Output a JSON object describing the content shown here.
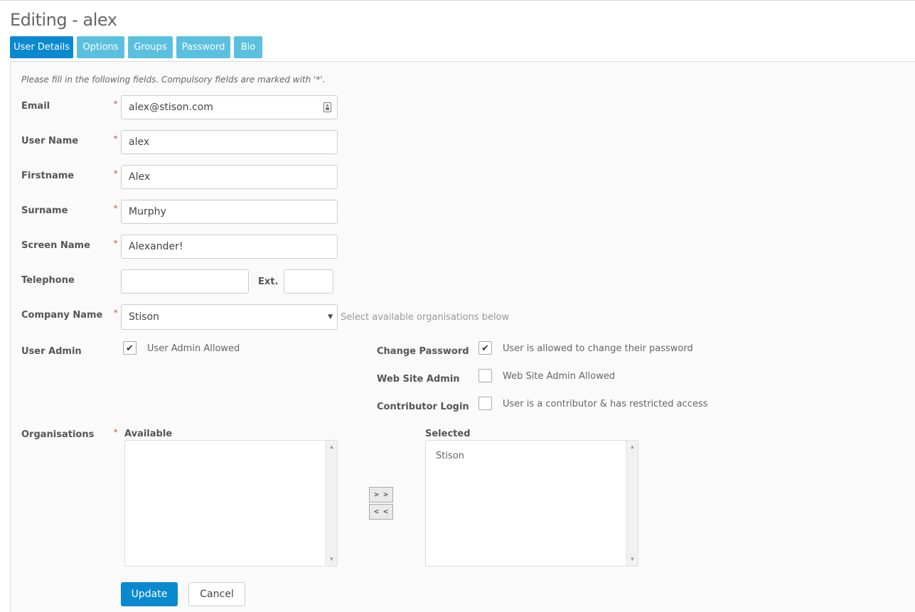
{
  "page": {
    "title": "Editing - alex"
  },
  "tabs": [
    {
      "label": "User Details"
    },
    {
      "label": "Options"
    },
    {
      "label": "Groups"
    },
    {
      "label": "Password"
    },
    {
      "label": "Bio"
    }
  ],
  "form": {
    "instructions": "Please fill in the following fields. Compulsory fields are marked with '*'.",
    "required_marker": "*",
    "email": {
      "label": "Email",
      "value": "alex@stison.com"
    },
    "username": {
      "label": "User Name",
      "value": "alex"
    },
    "firstname": {
      "label": "Firstname",
      "value": "Alex"
    },
    "surname": {
      "label": "Surname",
      "value": "Murphy"
    },
    "screenname": {
      "label": "Screen Name",
      "value": "Alexander!"
    },
    "telephone": {
      "label": "Telephone",
      "value": "",
      "ext_label": "Ext.",
      "ext_value": ""
    },
    "company": {
      "label": "Company Name",
      "value": "Stison",
      "hint": "Select available organisations below"
    },
    "user_admin": {
      "label": "User Admin",
      "checkbox_label": "User Admin Allowed",
      "checked": true
    },
    "change_password": {
      "label": "Change Password",
      "checkbox_label": "User is allowed to change their password",
      "checked": true
    },
    "web_site_admin": {
      "label": "Web Site Admin",
      "checkbox_label": "Web Site Admin Allowed",
      "checked": false
    },
    "contributor_login": {
      "label": "Contributor Login",
      "checkbox_label": "User is a contributor & has restricted access",
      "checked": false
    },
    "organisations": {
      "label": "Organisations",
      "available_label": "Available",
      "selected_label": "Selected",
      "available": [],
      "selected": [
        "Stison"
      ],
      "add_label": "> >",
      "remove_label": "< <"
    },
    "update_label": "Update",
    "cancel_label": "Cancel"
  },
  "check_glyph": "✔"
}
